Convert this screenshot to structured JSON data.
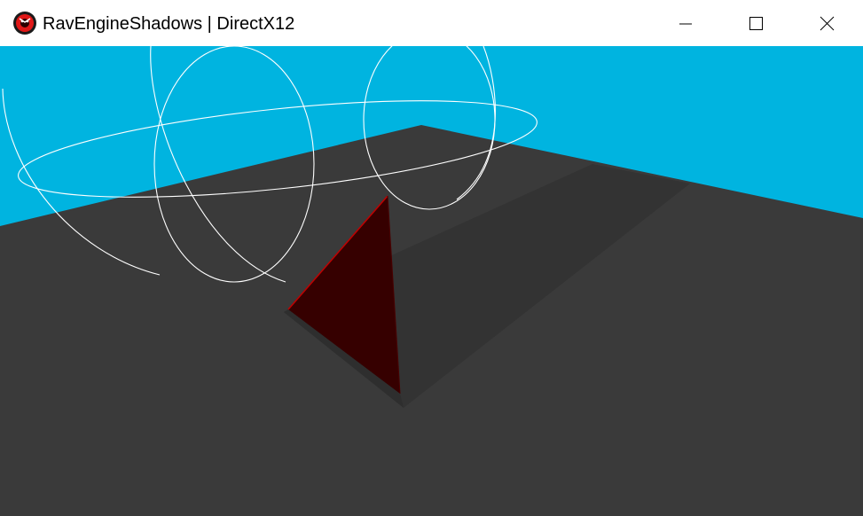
{
  "window": {
    "title": "RavEngineShadows | DirectX12",
    "icon": "raven-engine-logo-icon",
    "controls": {
      "minimize_icon": "minimize-icon",
      "maximize_icon": "maximize-icon",
      "close_icon": "close-icon"
    }
  },
  "scene": {
    "sky_color": "#00b4e0",
    "floor_color": "#3a3a3a",
    "shadow_color": "#333333",
    "pyramid_color": "#360000",
    "pyramid_edge_color": "#c00000",
    "gizmo_color": "#ffffff"
  }
}
